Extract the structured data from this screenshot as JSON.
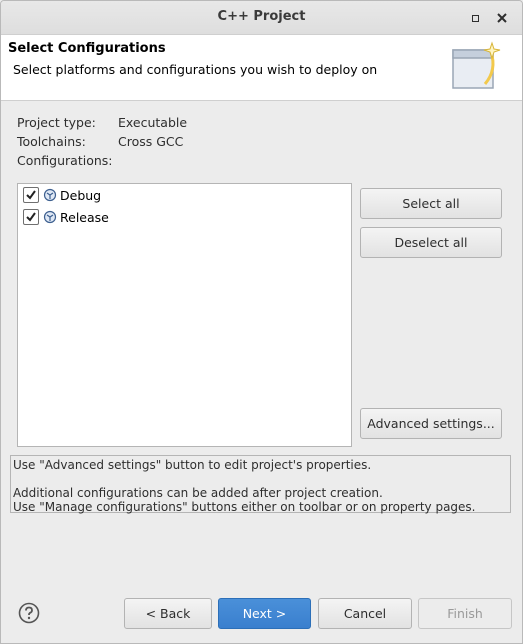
{
  "window": {
    "title": "C++ Project"
  },
  "header": {
    "title": "Select Configurations",
    "subtitle": "Select platforms and configurations you wish to deploy on"
  },
  "info": {
    "project_type_label": "Project type:",
    "project_type_value": "Executable",
    "toolchains_label": "Toolchains:",
    "toolchains_value": "Cross GCC",
    "configurations_label": "Configurations:"
  },
  "configurations": [
    {
      "label": "Debug",
      "checked": true
    },
    {
      "label": "Release",
      "checked": true
    }
  ],
  "side_buttons": {
    "select_all": "Select all",
    "deselect_all": "Deselect all",
    "advanced": "Advanced settings..."
  },
  "messages": {
    "line1": "Use \"Advanced settings\" button to edit project's properties.",
    "line2": "Additional configurations can be added after project creation.",
    "line3": "Use \"Manage configurations\" buttons either on toolbar or on property pages."
  },
  "footer": {
    "back": "< Back",
    "next": "Next >",
    "cancel": "Cancel",
    "finish": "Finish"
  },
  "colors": {
    "primary_button": "#3a7fce",
    "background": "#ececec"
  }
}
